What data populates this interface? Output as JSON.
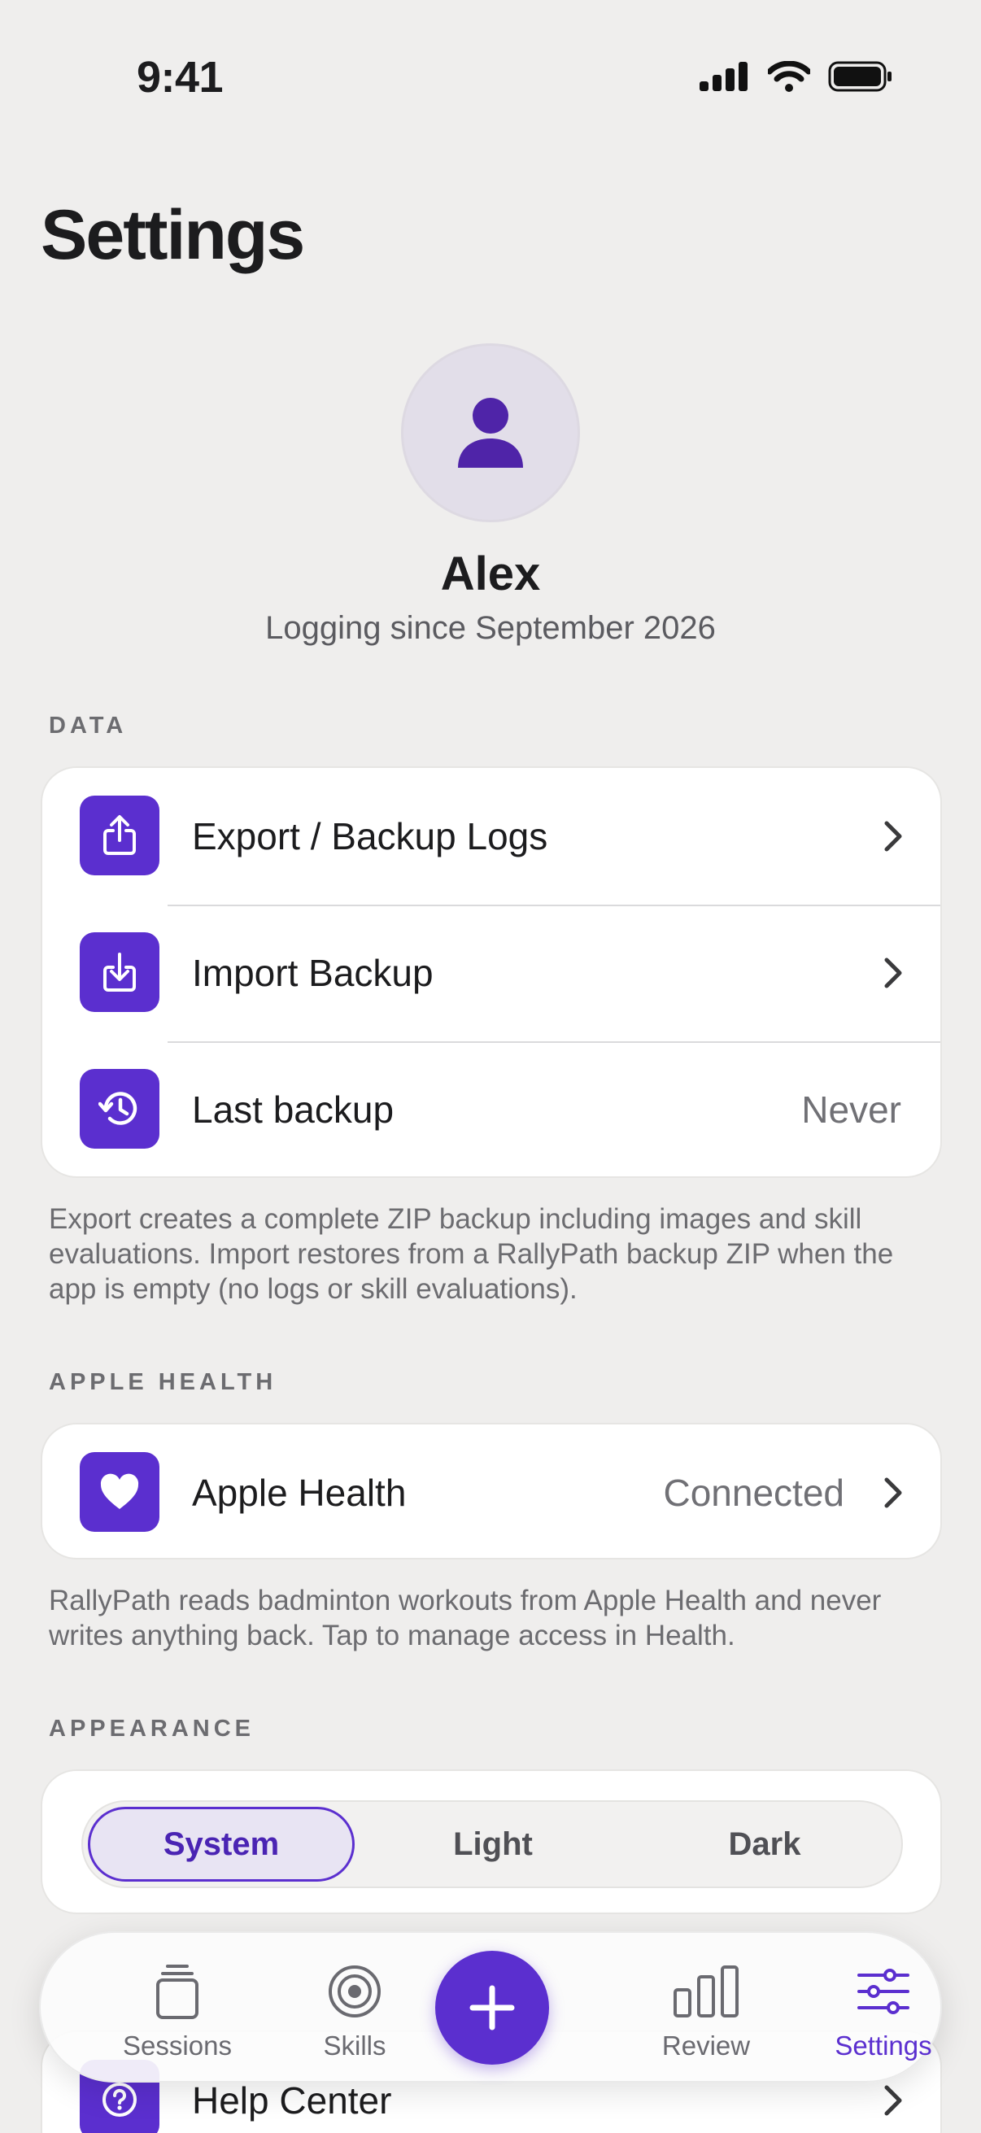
{
  "status_bar": {
    "time": "9:41"
  },
  "page": {
    "title": "Settings"
  },
  "profile": {
    "name": "Alex",
    "subtitle": "Logging since September 2026",
    "avatar_icon": "person-icon"
  },
  "sections": {
    "data": {
      "header": "DATA",
      "rows": [
        {
          "label": "Export / Backup Logs",
          "icon": "share-icon"
        },
        {
          "label": "Import Backup",
          "icon": "download-icon"
        },
        {
          "label": "Last backup",
          "value": "Never",
          "icon": "history-icon"
        }
      ],
      "footnote": "Export creates a complete ZIP backup including images and skill evaluations. Import restores from a RallyPath backup ZIP when the app is empty (no logs or skill evaluations)."
    },
    "apple_health": {
      "header": "APPLE HEALTH",
      "rows": [
        {
          "label": "Apple Health",
          "value": "Connected",
          "icon": "heart-icon"
        }
      ],
      "footnote": "RallyPath reads badminton workouts from Apple Health and never writes anything back. Tap to manage access in Health."
    },
    "appearance": {
      "header": "APPEARANCE",
      "options": [
        "System",
        "Light",
        "Dark"
      ],
      "selected": "System"
    },
    "support": {
      "rows": [
        {
          "label": "Help Center",
          "icon": "question-icon"
        }
      ]
    }
  },
  "tabbar": {
    "tabs": [
      {
        "label": "Sessions",
        "icon": "sessions-icon"
      },
      {
        "label": "Skills",
        "icon": "target-icon"
      },
      {
        "label": "Review",
        "icon": "bar-chart-icon"
      },
      {
        "label": "Settings",
        "icon": "sliders-icon"
      }
    ],
    "active": "Settings",
    "add_icon": "plus-icon"
  },
  "colors": {
    "accent": "#5B2FCF",
    "background": "#EFEEED",
    "card": "#FFFFFF",
    "secondary_text": "#6C6C70"
  }
}
